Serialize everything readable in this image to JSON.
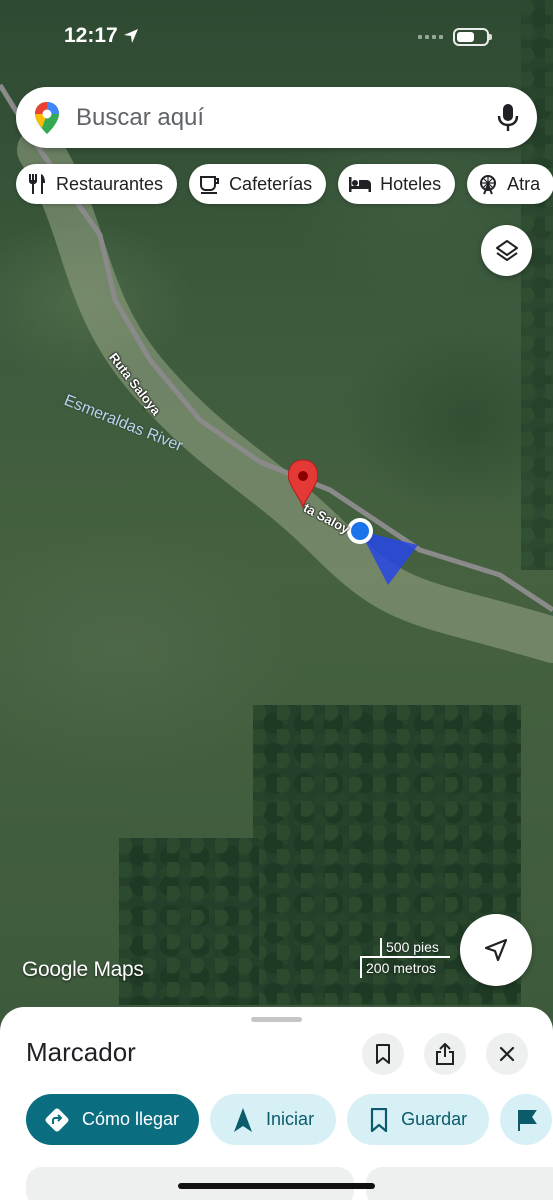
{
  "status_bar": {
    "time": "12:17"
  },
  "search": {
    "placeholder": "Buscar aquí"
  },
  "chips": [
    {
      "label": "Restaurantes",
      "icon": "fork-knife-icon"
    },
    {
      "label": "Cafeterías",
      "icon": "coffee-cup-icon"
    },
    {
      "label": "Hoteles",
      "icon": "bed-icon"
    },
    {
      "label": "Atra",
      "icon": "ferris-wheel-icon"
    }
  ],
  "map": {
    "road_label_1": "Ruta Saloya",
    "road_label_2": "ta Saloy",
    "river_label": "Esmeraldas River",
    "logo": "Google Maps",
    "scale_imperial": "500 pies",
    "scale_metric": "200 metros",
    "marker_color": "#e53935",
    "location_color": "#1a73e8"
  },
  "sheet": {
    "title": "Marcador",
    "actions": {
      "directions": "Cómo llegar",
      "start": "Iniciar",
      "save": "Guardar"
    },
    "accent": "#0b6e80"
  }
}
